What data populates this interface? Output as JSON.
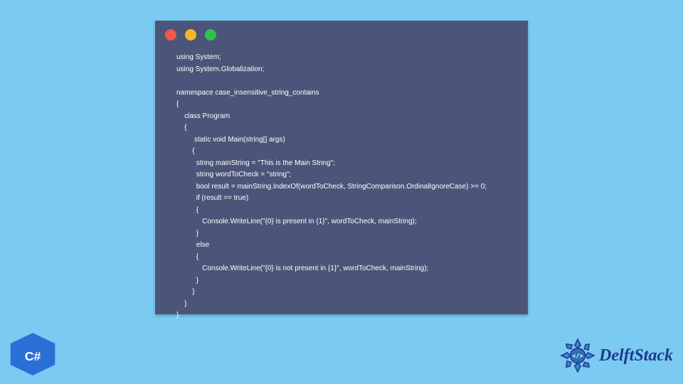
{
  "traffic_lights": {
    "red": "#f3564b",
    "yellow": "#f6b62c",
    "green": "#2fc24a"
  },
  "code": "using System;\nusing System.Globalization;\n\nnamespace case_insensitive_string_contains\n{\n    class Program\n    {\n         static void Main(string[] args)\n        {\n          string mainString = \"This is the Main String\";\n          string wordToCheck = \"string\";\n          bool result = mainString.IndexOf(wordToCheck, StringComparison.OrdinalIgnoreCase) >= 0;\n          if (result == true)\n          {\n             Console.WriteLine(\"{0} is present in {1}\", wordToCheck, mainString);\n          }\n          else\n          {\n             Console.WriteLine(\"{0} is not present in {1}\", wordToCheck, mainString);\n          }\n        }\n    }\n}",
  "csharp_label": "C#",
  "brand": "DelftStack"
}
